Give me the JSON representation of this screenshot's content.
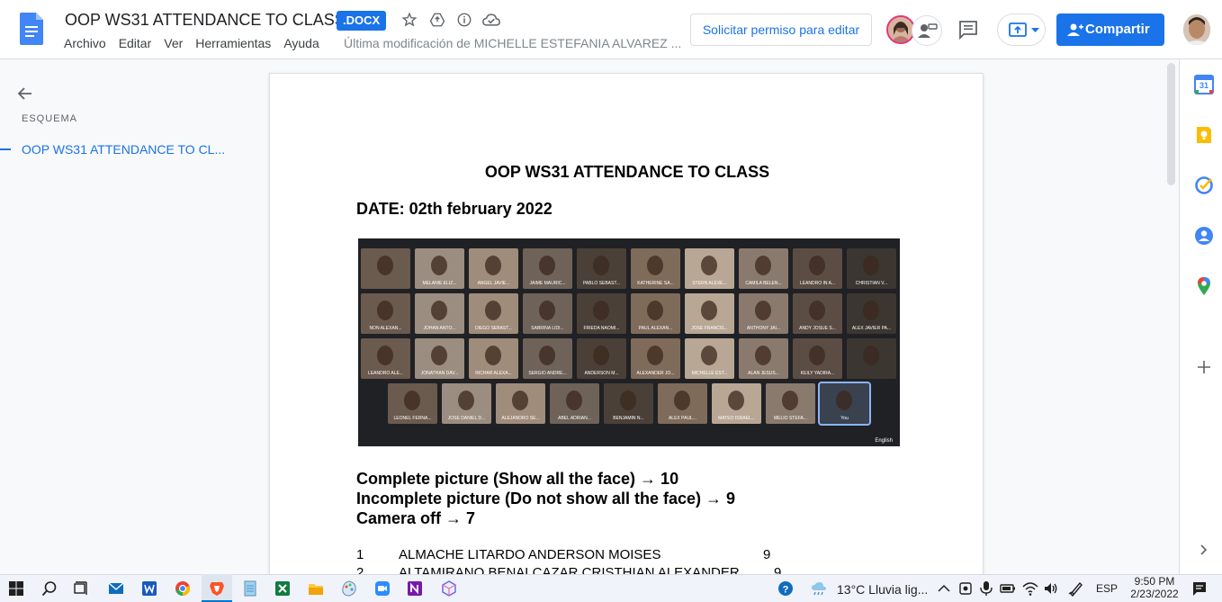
{
  "header": {
    "doc_title": "OOP WS31 ATTENDANCE TO CLASS",
    "file_badge": ".DOCX",
    "menu": [
      "Archivo",
      "Editar",
      "Ver",
      "Herramientas",
      "Ayuda"
    ],
    "last_modified": "Última modificación de MICHELLE ESTEFANIA ALVAREZ ...",
    "request_edit": "Solicitar permiso para editar",
    "share": "Compartir",
    "icons": [
      "docs-logo-icon",
      "star-icon",
      "move-to-drive-icon",
      "info-icon",
      "cloud-status-icon",
      "comments-icon",
      "present-icon",
      "share-icon"
    ]
  },
  "outline": {
    "label": "ESQUEMA",
    "items": [
      "OOP WS31 ATTENDANCE TO CL..."
    ]
  },
  "document": {
    "title": "OOP WS31 ATTENDANCE TO CLASS",
    "date": "DATE: 02th february 2022",
    "meeting": {
      "tiles": [
        "",
        "MELANIE ELIZ...",
        "ANGEL JAVIE...",
        "JAIME MAURIC...",
        "PABLO SEBAST...",
        "KATHERINE SA...",
        "STERN ALEXE...",
        "CAMILA BELEN...",
        "LEANDRO IN A...",
        "CHRISTIAN V...",
        "NON ALEXAN...",
        "JOHAN ANTO...",
        "DIEGO SEBAST...",
        "SABRINA LIDI...",
        "FRIEDA NAOMI...",
        "PAUL ALEXAN...",
        "JOSE FRANCIS...",
        "ANTHONY JAI...",
        "ANDY JOSUE S...",
        "ALEX JAVIER PA...",
        "LEANDRO ALE...",
        "JONATHAN DAV...",
        "RICHAR ALEXA...",
        "SERGIO ANDRE...",
        "ANDERSON M...",
        "ALEXANDER JO...",
        "MICHELLE EST...",
        "ALAN JESÚS...",
        "KEILY YADIRA...",
        "",
        "LEONEL FERNA...",
        "JOSE DANIEL D...",
        "ALEJANDRO SE...",
        "ABEL ADRIAN...",
        "BENJAMIN N...",
        "ALEX PAUL...",
        "MATEO ISRAEL...",
        "MELIO STEFA...",
        "You"
      ],
      "language": "English"
    },
    "grading": [
      "Complete picture (Show all the face) → 10",
      "Incomplete picture (Do not show all the face) → 9",
      "Camera off → 7"
    ],
    "list": [
      {
        "n": "1",
        "name": "ALMACHE LITARDO ANDERSON MOISES",
        "score": "9"
      },
      {
        "n": "2",
        "name": "ALTAMIRANO BENALCAZAR CRISTHIAN ALEXANDER",
        "score": "9"
      }
    ]
  },
  "side_panel": {
    "icons": [
      "calendar-icon",
      "keep-icon",
      "tasks-icon",
      "contacts-icon",
      "maps-icon",
      "add-icon",
      "expand-icon"
    ],
    "calendar_day": "31"
  },
  "taskbar": {
    "weather": "13°C  Lluvia lig...",
    "language": "ESP",
    "time": "9:50 PM",
    "date": "2/23/2022"
  },
  "colors": {
    "accent": "#1a73e8",
    "meet_bg": "#202124"
  }
}
